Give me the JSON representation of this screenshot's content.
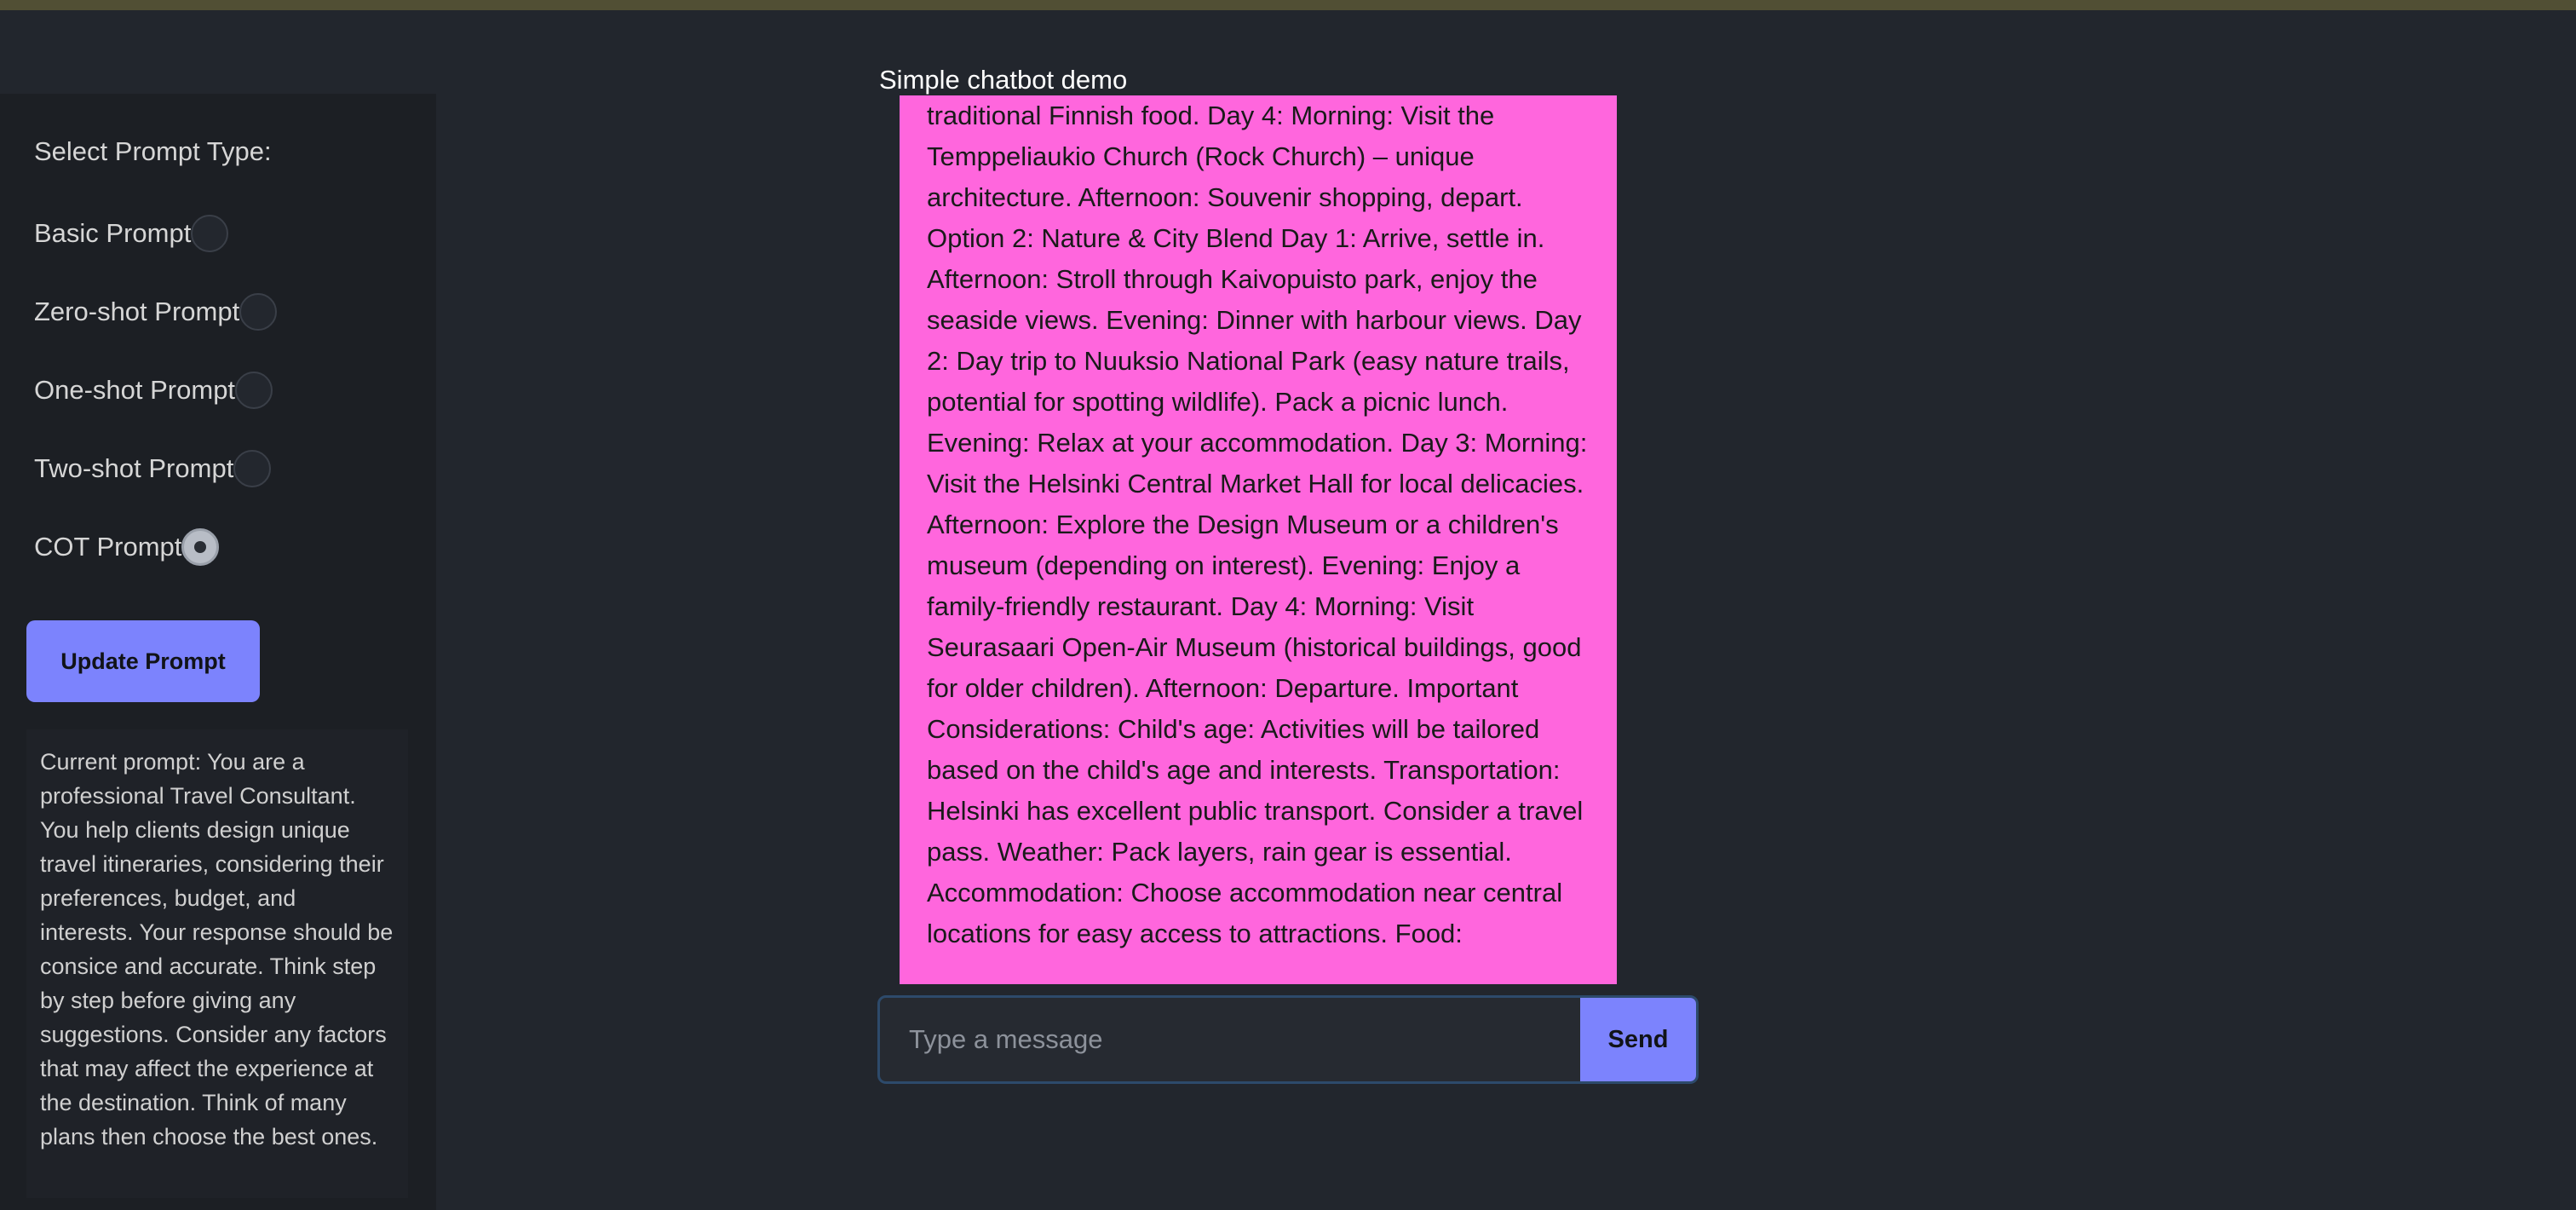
{
  "app": {
    "demo_title": "Simple chatbot demo"
  },
  "sidebar": {
    "section_title": "Select Prompt Type:",
    "options": [
      {
        "label": "Basic Prompt",
        "selected": false
      },
      {
        "label": "Zero-shot Prompt",
        "selected": false
      },
      {
        "label": "One-shot Prompt",
        "selected": false
      },
      {
        "label": "Two-shot Prompt",
        "selected": false
      },
      {
        "label": "COT Prompt",
        "selected": true
      }
    ],
    "update_button_label": "Update Prompt",
    "current_prompt_text": "Current prompt: You are a professional Travel Consultant. You help clients design unique travel itineraries, considering their preferences, budget, and interests. Your response should be consice and accurate. Think step by step before giving any suggestions. Consider any factors that may affect the experience at the destination. Think of many plans then choose the best ones."
  },
  "chat": {
    "message_text": "traditional Finnish food. Day 4: Morning: Visit the Temppeliaukio Church (Rock Church) – unique architecture. Afternoon: Souvenir shopping, depart. Option 2: Nature & City Blend Day 1: Arrive, settle in. Afternoon: Stroll through Kaivopuisto park, enjoy the seaside views. Evening: Dinner with harbour views. Day 2: Day trip to Nuuksio National Park (easy nature trails, potential for spotting wildlife). Pack a picnic lunch. Evening: Relax at your accommodation. Day 3: Morning: Visit the Helsinki Central Market Hall for local delicacies. Afternoon: Explore the Design Museum or a children's museum (depending on interest). Evening: Enjoy a family-friendly restaurant. Day 4: Morning: Visit Seurasaari Open-Air Museum (historical buildings, good for older children). Afternoon: Departure. Important Considerations: Child's age: Activities will be tailored based on the child's age and interests. Transportation: Helsinki has excellent public transport. Consider a travel pass. Weather: Pack layers, rain gear is essential. Accommodation: Choose accommodation near central locations for easy access to attractions. Food:",
    "input_placeholder": "Type a message",
    "input_value": "",
    "send_button_label": "Send"
  },
  "colors": {
    "accent": "#7c83fd",
    "chat_bubble": "#ff66dd",
    "background": "#22262d",
    "sidebar": "#1c1f24"
  }
}
